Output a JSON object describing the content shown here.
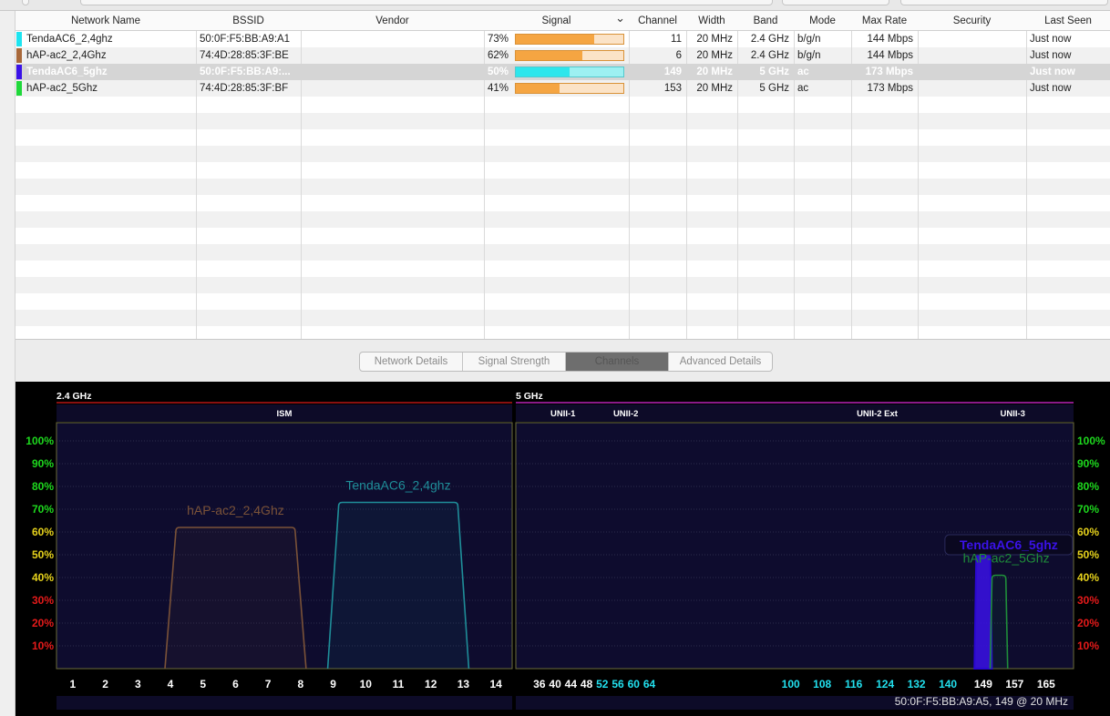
{
  "table": {
    "columns": [
      {
        "key": "name",
        "label": "Network Name"
      },
      {
        "key": "bssid",
        "label": "BSSID"
      },
      {
        "key": "vendor",
        "label": "Vendor"
      },
      {
        "key": "signal",
        "label": "Signal"
      },
      {
        "key": "channel",
        "label": "Channel"
      },
      {
        "key": "width",
        "label": "Width"
      },
      {
        "key": "band",
        "label": "Band"
      },
      {
        "key": "mode",
        "label": "Mode"
      },
      {
        "key": "max_rate",
        "label": "Max Rate"
      },
      {
        "key": "security",
        "label": "Security"
      },
      {
        "key": "last_seen",
        "label": "Last Seen"
      }
    ],
    "sorted_column": "signal",
    "rows": [
      {
        "color": "#1ee4f0",
        "name": "TendaAC6_2,4ghz",
        "bssid": "50:0F:F5:BB:A9:A1",
        "vendor": "",
        "signal": "73%",
        "signal_level": 0.73,
        "channel": "11",
        "width": "20 MHz",
        "band": "2.4 GHz",
        "mode": "b/g/n",
        "max_rate": "144 Mbps",
        "security": "",
        "last_seen": "Just now",
        "selected": false
      },
      {
        "color": "#a8683a",
        "name": "hAP-ac2_2,4Ghz",
        "bssid": "74:4D:28:85:3F:BE",
        "vendor": "",
        "signal": "62%",
        "signal_level": 0.62,
        "channel": "6",
        "width": "20 MHz",
        "band": "2.4 GHz",
        "mode": "b/g/n",
        "max_rate": "144 Mbps",
        "security": "",
        "last_seen": "Just now",
        "selected": false
      },
      {
        "color": "#3a12e8",
        "name": "TendaAC6_5ghz",
        "bssid": "50:0F:F5:BB:A9:...",
        "vendor": "",
        "signal": "50%",
        "signal_level": 0.5,
        "channel": "149",
        "width": "20 MHz",
        "band": "5 GHz",
        "mode": "ac",
        "max_rate": "173 Mbps",
        "security": "",
        "last_seen": "Just now",
        "selected": true
      },
      {
        "color": "#1fd83a",
        "name": "hAP-ac2_5Ghz",
        "bssid": "74:4D:28:85:3F:BF",
        "vendor": "",
        "signal": "41%",
        "signal_level": 0.41,
        "channel": "153",
        "width": "20 MHz",
        "band": "5 GHz",
        "mode": "ac",
        "max_rate": "173 Mbps",
        "security": "",
        "last_seen": "Just now",
        "selected": false
      }
    ]
  },
  "tabs": [
    {
      "label": "Network Details",
      "active": false
    },
    {
      "label": "Signal Strength",
      "active": false
    },
    {
      "label": "Channels",
      "active": true
    },
    {
      "label": "Advanced Details",
      "active": false
    }
  ],
  "chart_data": {
    "type": "area",
    "y_ticks": [
      "10%",
      "20%",
      "30%",
      "40%",
      "50%",
      "60%",
      "70%",
      "80%",
      "90%",
      "100%"
    ],
    "y_range": [
      0,
      100
    ],
    "tick_colors": {
      "low": "#e41a1a",
      "mid": "#e6d21c",
      "high": "#1ed81e"
    },
    "panels": [
      {
        "band_label": "2.4 GHz",
        "band_color": "#8a1010",
        "regions": [
          {
            "label": "ISM",
            "from": 0.5,
            "to": 14.5
          }
        ],
        "x_range": [
          0.5,
          14.5
        ],
        "x_ticks": [
          {
            "label": "1",
            "value": 1,
            "color": "#ffffff"
          },
          {
            "label": "2",
            "value": 2,
            "color": "#ffffff"
          },
          {
            "label": "3",
            "value": 3,
            "color": "#ffffff"
          },
          {
            "label": "4",
            "value": 4,
            "color": "#ffffff"
          },
          {
            "label": "5",
            "value": 5,
            "color": "#ffffff"
          },
          {
            "label": "6",
            "value": 6,
            "color": "#ffffff"
          },
          {
            "label": "7",
            "value": 7,
            "color": "#ffffff"
          },
          {
            "label": "8",
            "value": 8,
            "color": "#ffffff"
          },
          {
            "label": "9",
            "value": 9,
            "color": "#ffffff"
          },
          {
            "label": "10",
            "value": 10,
            "color": "#ffffff"
          },
          {
            "label": "11",
            "value": 11,
            "color": "#ffffff"
          },
          {
            "label": "12",
            "value": 12,
            "color": "#ffffff"
          },
          {
            "label": "13",
            "value": 13,
            "color": "#ffffff"
          },
          {
            "label": "14",
            "value": 14,
            "color": "#ffffff"
          }
        ],
        "series": [
          {
            "name": "hAP-ac2_2,4Ghz",
            "from": 4,
            "to": 8,
            "value": 62,
            "color": "#7a5238",
            "selected": false
          },
          {
            "name": "TendaAC6_2,4ghz",
            "from": 9,
            "to": 13,
            "value": 73,
            "color": "#1f8e99",
            "selected": false
          }
        ]
      },
      {
        "band_label": "5 GHz",
        "band_color": "#8a1a8a",
        "regions": [
          {
            "label": "UNII-1",
            "from": 34,
            "to": 50
          },
          {
            "label": "UNII-2",
            "from": 50,
            "to": 66
          },
          {
            "label": "UNII-2 Ext",
            "from": 98,
            "to": 146
          },
          {
            "label": "UNII-3",
            "from": 146,
            "to": 167
          }
        ],
        "x_range": [
          30,
          172
        ],
        "x_ticks": [
          {
            "label": "36",
            "value": 36,
            "color": "#ffffff"
          },
          {
            "label": "40",
            "value": 40,
            "color": "#ffffff"
          },
          {
            "label": "44",
            "value": 44,
            "color": "#ffffff"
          },
          {
            "label": "48",
            "value": 48,
            "color": "#ffffff"
          },
          {
            "label": "52",
            "value": 52,
            "color": "#22e0ee"
          },
          {
            "label": "56",
            "value": 56,
            "color": "#22e0ee"
          },
          {
            "label": "60",
            "value": 60,
            "color": "#22e0ee"
          },
          {
            "label": "64",
            "value": 64,
            "color": "#22e0ee"
          },
          {
            "label": "100",
            "value": 100,
            "color": "#22e0ee"
          },
          {
            "label": "108",
            "value": 108,
            "color": "#22e0ee"
          },
          {
            "label": "116",
            "value": 116,
            "color": "#22e0ee"
          },
          {
            "label": "124",
            "value": 124,
            "color": "#22e0ee"
          },
          {
            "label": "132",
            "value": 132,
            "color": "#22e0ee"
          },
          {
            "label": "140",
            "value": 140,
            "color": "#22e0ee"
          },
          {
            "label": "149",
            "value": 149,
            "color": "#ffffff"
          },
          {
            "label": "157",
            "value": 157,
            "color": "#ffffff"
          },
          {
            "label": "165",
            "value": 165,
            "color": "#ffffff"
          }
        ],
        "series": [
          {
            "name": "TendaAC6_5ghz",
            "from": 147,
            "to": 151,
            "value": 50,
            "color": "#3a12e8",
            "selected": true
          },
          {
            "name": "hAP-ac2_5Ghz",
            "from": 151,
            "to": 155,
            "value": 41,
            "color": "#1f8e3a",
            "selected": false
          }
        ]
      }
    ],
    "status_text": "50:0F:F5:BB:A9:A5, 149 @ 20 MHz"
  }
}
